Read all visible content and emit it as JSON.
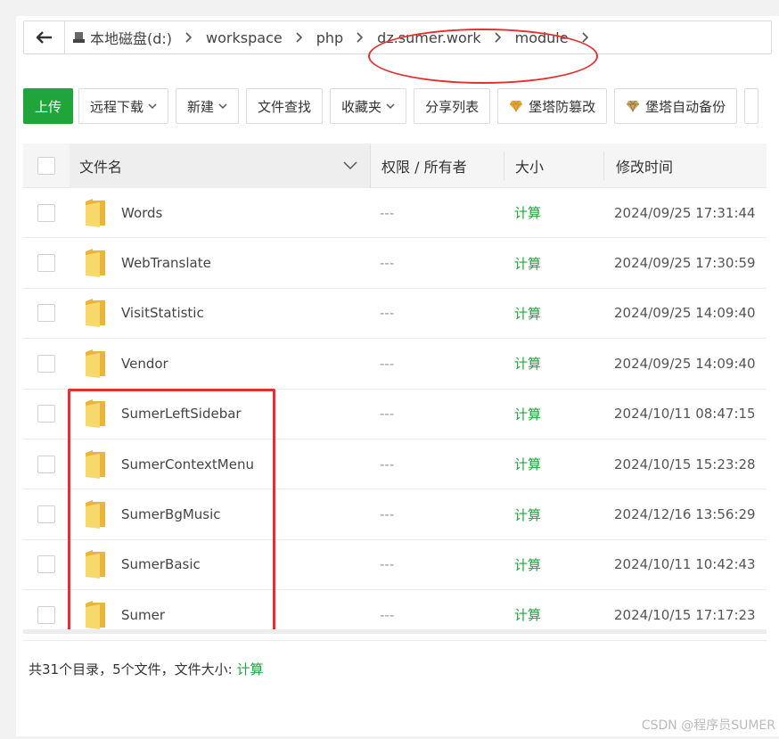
{
  "breadcrumb": {
    "disk": "本地磁盘(d:)",
    "segments": [
      "workspace",
      "php",
      "dz.sumer.work",
      "module"
    ]
  },
  "toolbar": {
    "upload": "上传",
    "remote_download": "远程下载",
    "new": "新建",
    "file_search": "文件查找",
    "favorites": "收藏夹",
    "share_list": "分享列表",
    "tamper_proof": "堡塔防篡改",
    "auto_backup": "堡塔自动备份"
  },
  "table": {
    "headers": {
      "name": "文件名",
      "perm": "权限 / 所有者",
      "size": "大小",
      "time": "修改时间"
    },
    "rows": [
      {
        "name": "Words",
        "perm": "---",
        "size": "计算",
        "time": "2024/09/25 17:31:44"
      },
      {
        "name": "WebTranslate",
        "perm": "---",
        "size": "计算",
        "time": "2024/09/25 17:30:59"
      },
      {
        "name": "VisitStatistic",
        "perm": "---",
        "size": "计算",
        "time": "2024/09/25 14:09:40"
      },
      {
        "name": "Vendor",
        "perm": "---",
        "size": "计算",
        "time": "2024/09/25 14:09:40"
      },
      {
        "name": "SumerLeftSidebar",
        "perm": "---",
        "size": "计算",
        "time": "2024/10/11 08:47:15"
      },
      {
        "name": "SumerContextMenu",
        "perm": "---",
        "size": "计算",
        "time": "2024/10/15 15:23:28"
      },
      {
        "name": "SumerBgMusic",
        "perm": "---",
        "size": "计算",
        "time": "2024/12/16 13:56:29"
      },
      {
        "name": "SumerBasic",
        "perm": "---",
        "size": "计算",
        "time": "2024/10/11 10:42:43"
      },
      {
        "name": "Sumer",
        "perm": "---",
        "size": "计算",
        "time": "2024/10/15 17:17:23"
      }
    ]
  },
  "footer": {
    "summary": "共31个目录，5个文件，文件大小:",
    "calc": "计算"
  },
  "watermark": "CSDN @程序员SUMER",
  "colors": {
    "accent": "#20a53a",
    "annotation": "#e53030",
    "folder": "#f5c84c"
  }
}
